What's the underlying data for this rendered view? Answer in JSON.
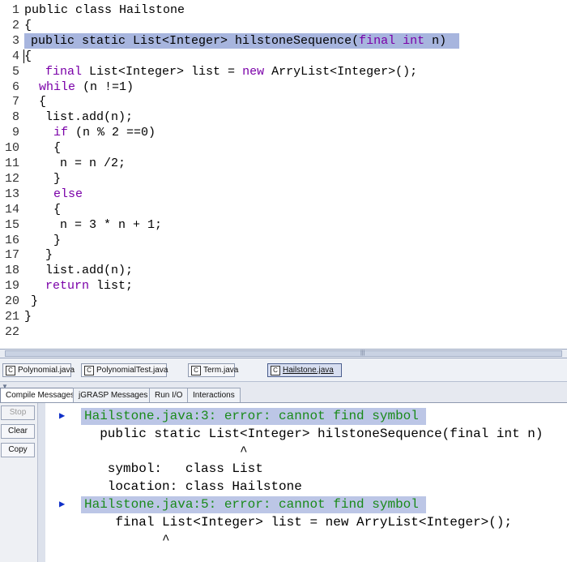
{
  "editor": {
    "lines": [
      {
        "num": "1",
        "segments": [
          {
            "text": "public class Hailstone",
            "kw": false
          }
        ]
      },
      {
        "num": "2",
        "segments": [
          {
            "text": "{",
            "kw": false
          }
        ]
      },
      {
        "num": "3",
        "segments": [
          {
            "text": "public static List<Integer> hilstoneSequence(",
            "kw": false
          },
          {
            "text": "final",
            "kw": true
          },
          {
            "text": " ",
            "kw": false
          },
          {
            "text": "int",
            "kw": true
          },
          {
            "text": " n)",
            "kw": false
          }
        ]
      },
      {
        "num": "4",
        "segments": [
          {
            "text": "{",
            "kw": false
          }
        ]
      },
      {
        "num": "5",
        "segments": [
          {
            "text": "final",
            "kw": true
          },
          {
            "text": " List<Integer> list = ",
            "kw": false
          },
          {
            "text": "new",
            "kw": true
          },
          {
            "text": " ArryList<Integer>();",
            "kw": false
          }
        ]
      },
      {
        "num": "6",
        "segments": [
          {
            "text": "while",
            "kw": true
          },
          {
            "text": " (n !=1)",
            "kw": false
          }
        ]
      },
      {
        "num": "7",
        "segments": [
          {
            "text": "{",
            "kw": false
          }
        ]
      },
      {
        "num": "8",
        "segments": [
          {
            "text": "list.add(n);",
            "kw": false
          }
        ]
      },
      {
        "num": "9",
        "segments": [
          {
            "text": "if",
            "kw": true
          },
          {
            "text": " (n % 2 ==0)",
            "kw": false
          }
        ]
      },
      {
        "num": "10",
        "segments": [
          {
            "text": "{",
            "kw": false
          }
        ]
      },
      {
        "num": "11",
        "segments": [
          {
            "text": "n = n /2;",
            "kw": false
          }
        ]
      },
      {
        "num": "12",
        "segments": [
          {
            "text": "}",
            "kw": false
          }
        ]
      },
      {
        "num": "13",
        "segments": [
          {
            "text": "else",
            "kw": true
          }
        ]
      },
      {
        "num": "14",
        "segments": [
          {
            "text": "{",
            "kw": false
          }
        ]
      },
      {
        "num": "15",
        "segments": [
          {
            "text": "n = 3 * n + 1;",
            "kw": false
          }
        ]
      },
      {
        "num": "16",
        "segments": [
          {
            "text": "}",
            "kw": false
          }
        ]
      },
      {
        "num": "17",
        "segments": [
          {
            "text": "}",
            "kw": false
          }
        ]
      },
      {
        "num": "18",
        "segments": [
          {
            "text": "list.add(n);",
            "kw": false
          }
        ]
      },
      {
        "num": "19",
        "segments": [
          {
            "text": "return",
            "kw": true
          },
          {
            "text": " list;",
            "kw": false
          }
        ]
      },
      {
        "num": "20",
        "segments": [
          {
            "text": "}",
            "kw": false
          }
        ]
      },
      {
        "num": "21",
        "segments": [
          {
            "text": "}",
            "kw": false
          }
        ]
      },
      {
        "num": "22",
        "segments": []
      }
    ],
    "highlighted_line": "3",
    "keyword_color": "#7a00a8",
    "highlight_color": "#a7b5de"
  },
  "file_tabs": [
    {
      "label": "Polynomial.java",
      "icon": "class-file-icon",
      "active": false
    },
    {
      "label": "PolynomialTest.java",
      "icon": "class-file-icon",
      "active": false
    },
    {
      "label": "Term.java",
      "icon": "class-file-icon",
      "active": false
    },
    {
      "label": "Hailstone.java",
      "icon": "class-file-icon",
      "active": true
    }
  ],
  "message_tabs": [
    {
      "label": "Compile Messages",
      "active": true
    },
    {
      "label": "jGRASP Messages",
      "active": false
    },
    {
      "label": "Run I/O",
      "active": false
    },
    {
      "label": "Interactions",
      "active": false
    }
  ],
  "side_buttons": [
    {
      "label": "Stop",
      "enabled": false
    },
    {
      "label": "Clear",
      "enabled": true
    },
    {
      "label": "Copy",
      "enabled": true
    }
  ],
  "messages": [
    {
      "text": "Hailstone.java:3: error: cannot find symbol",
      "type": "error"
    },
    {
      "text": "  public static List<Integer> hilstoneSequence(final int n)",
      "type": "plain"
    },
    {
      "text": "                    ^",
      "type": "plain"
    },
    {
      "text": "   symbol:   class List",
      "type": "plain"
    },
    {
      "text": "   location: class Hailstone",
      "type": "plain"
    },
    {
      "text": "Hailstone.java:5: error: cannot find symbol",
      "type": "error"
    },
    {
      "text": "    final List<Integer> list = new ArryList<Integer>();",
      "type": "plain"
    },
    {
      "text": "          ^",
      "type": "plain"
    }
  ],
  "colors": {
    "error_text": "#1a8a1a",
    "error_highlight": "#bcc6e6",
    "arrow": "#1030c8"
  }
}
